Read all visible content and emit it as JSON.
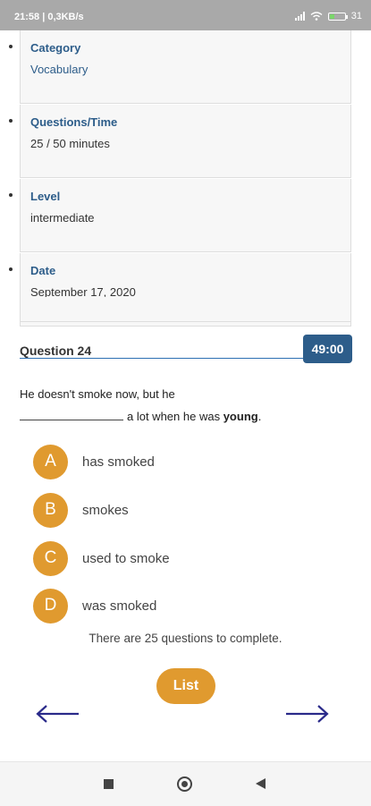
{
  "status_bar": {
    "time": "21:58 | 0,3KB/s",
    "battery": "31"
  },
  "info": [
    {
      "label": "Category",
      "value": "Vocabulary"
    },
    {
      "label": "Questions/Time",
      "value": "25 / 50 minutes"
    },
    {
      "label": "Level",
      "value": "intermediate"
    },
    {
      "label": "Date",
      "value": "September 17, 2020"
    }
  ],
  "question": {
    "title": "Question 24",
    "timer": "49:00",
    "line1": "He doesn't smoke now, but he",
    "line2_after_blank": "a lot when he was",
    "emphasis": "young",
    "end": "."
  },
  "answers": [
    {
      "letter": "A",
      "text": "has smoked"
    },
    {
      "letter": "B",
      "text": "smokes"
    },
    {
      "letter": "C",
      "text": "used to smoke"
    },
    {
      "letter": "D",
      "text": "was smoked"
    }
  ],
  "remaining_text": "There are 25 questions to complete.",
  "list_button": "List",
  "colors": {
    "accent": "#e09a2f",
    "primary": "#2d5d8a",
    "arrow": "#2a2a8a"
  }
}
